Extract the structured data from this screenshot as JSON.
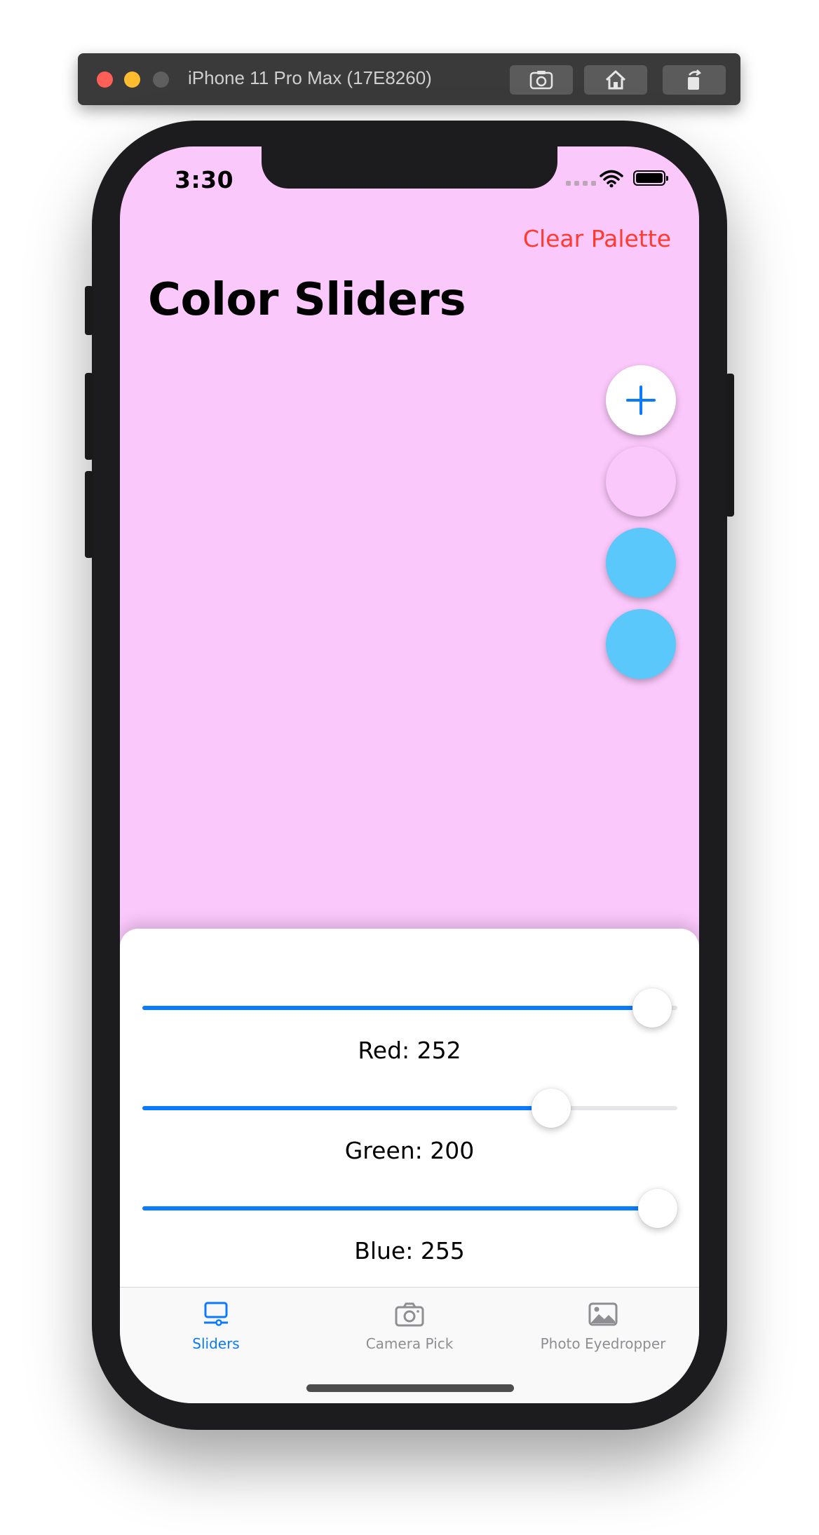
{
  "simulator": {
    "title": "iPhone 11 Pro Max (17E8260)",
    "buttons": [
      "screenshot-icon",
      "home-icon",
      "rotate-icon"
    ]
  },
  "status_bar": {
    "time": "3:30"
  },
  "nav": {
    "clear_palette_label": "Clear Palette",
    "title": "Color Sliders"
  },
  "colors": {
    "background": "#fbc8fb",
    "accent": "#0a7aff",
    "destructive": "#ff3b30"
  },
  "palette": {
    "add_icon": "plus-icon",
    "swatches": [
      "#fbc8fb",
      "#5ac8fa",
      "#5ac8fa"
    ]
  },
  "sliders": {
    "max": 255,
    "red": {
      "label": "Red: 252",
      "value": 252
    },
    "green": {
      "label": "Green: 200",
      "value": 200
    },
    "blue": {
      "label": "Blue: 255",
      "value": 255
    }
  },
  "tabs": [
    {
      "label": "Sliders",
      "icon": "sliders-icon",
      "active": true
    },
    {
      "label": "Camera Pick",
      "icon": "camera-icon",
      "active": false
    },
    {
      "label": "Photo Eyedropper",
      "icon": "photo-icon",
      "active": false
    }
  ]
}
